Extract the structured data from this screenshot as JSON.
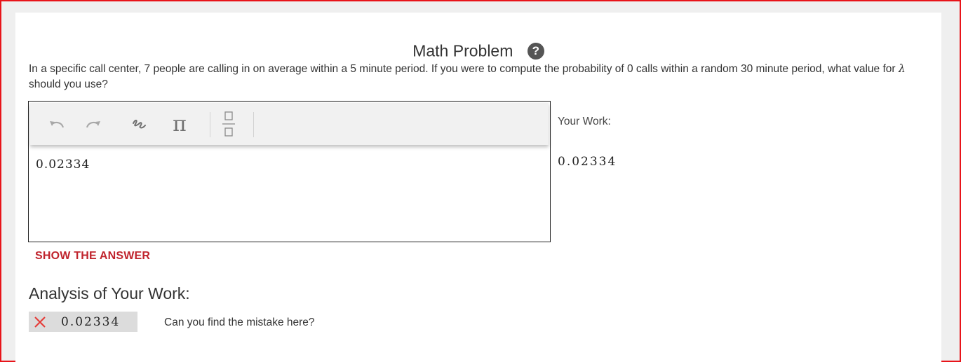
{
  "problem": {
    "title": "Math Problem",
    "text_before": "In a specific call center, 7 people are calling in on average within a 5 minute period. If you were to compute the probability of  0 calls within a random 30 minute period, what value for ",
    "lambda": "λ",
    "text_after": " should you use?"
  },
  "toolbar": {
    "undo_icon": "undo-icon",
    "redo_icon": "redo-icon",
    "handwriting_icon": "handwriting-icon",
    "pi_symbol": "π",
    "fraction_icon": "fraction-icon"
  },
  "editor": {
    "value": "0.02334"
  },
  "your_work": {
    "label": "Your Work:",
    "value": "0.02334"
  },
  "show_answer_label": "SHOW THE ANSWER",
  "analysis": {
    "heading": "Analysis of Your Work:",
    "value": "0.02334",
    "status": "incorrect",
    "message": "Can you find the mistake here?"
  },
  "colors": {
    "accent_red": "#c0242d",
    "frame_red": "#e8141a",
    "x_red": "#e53935"
  }
}
